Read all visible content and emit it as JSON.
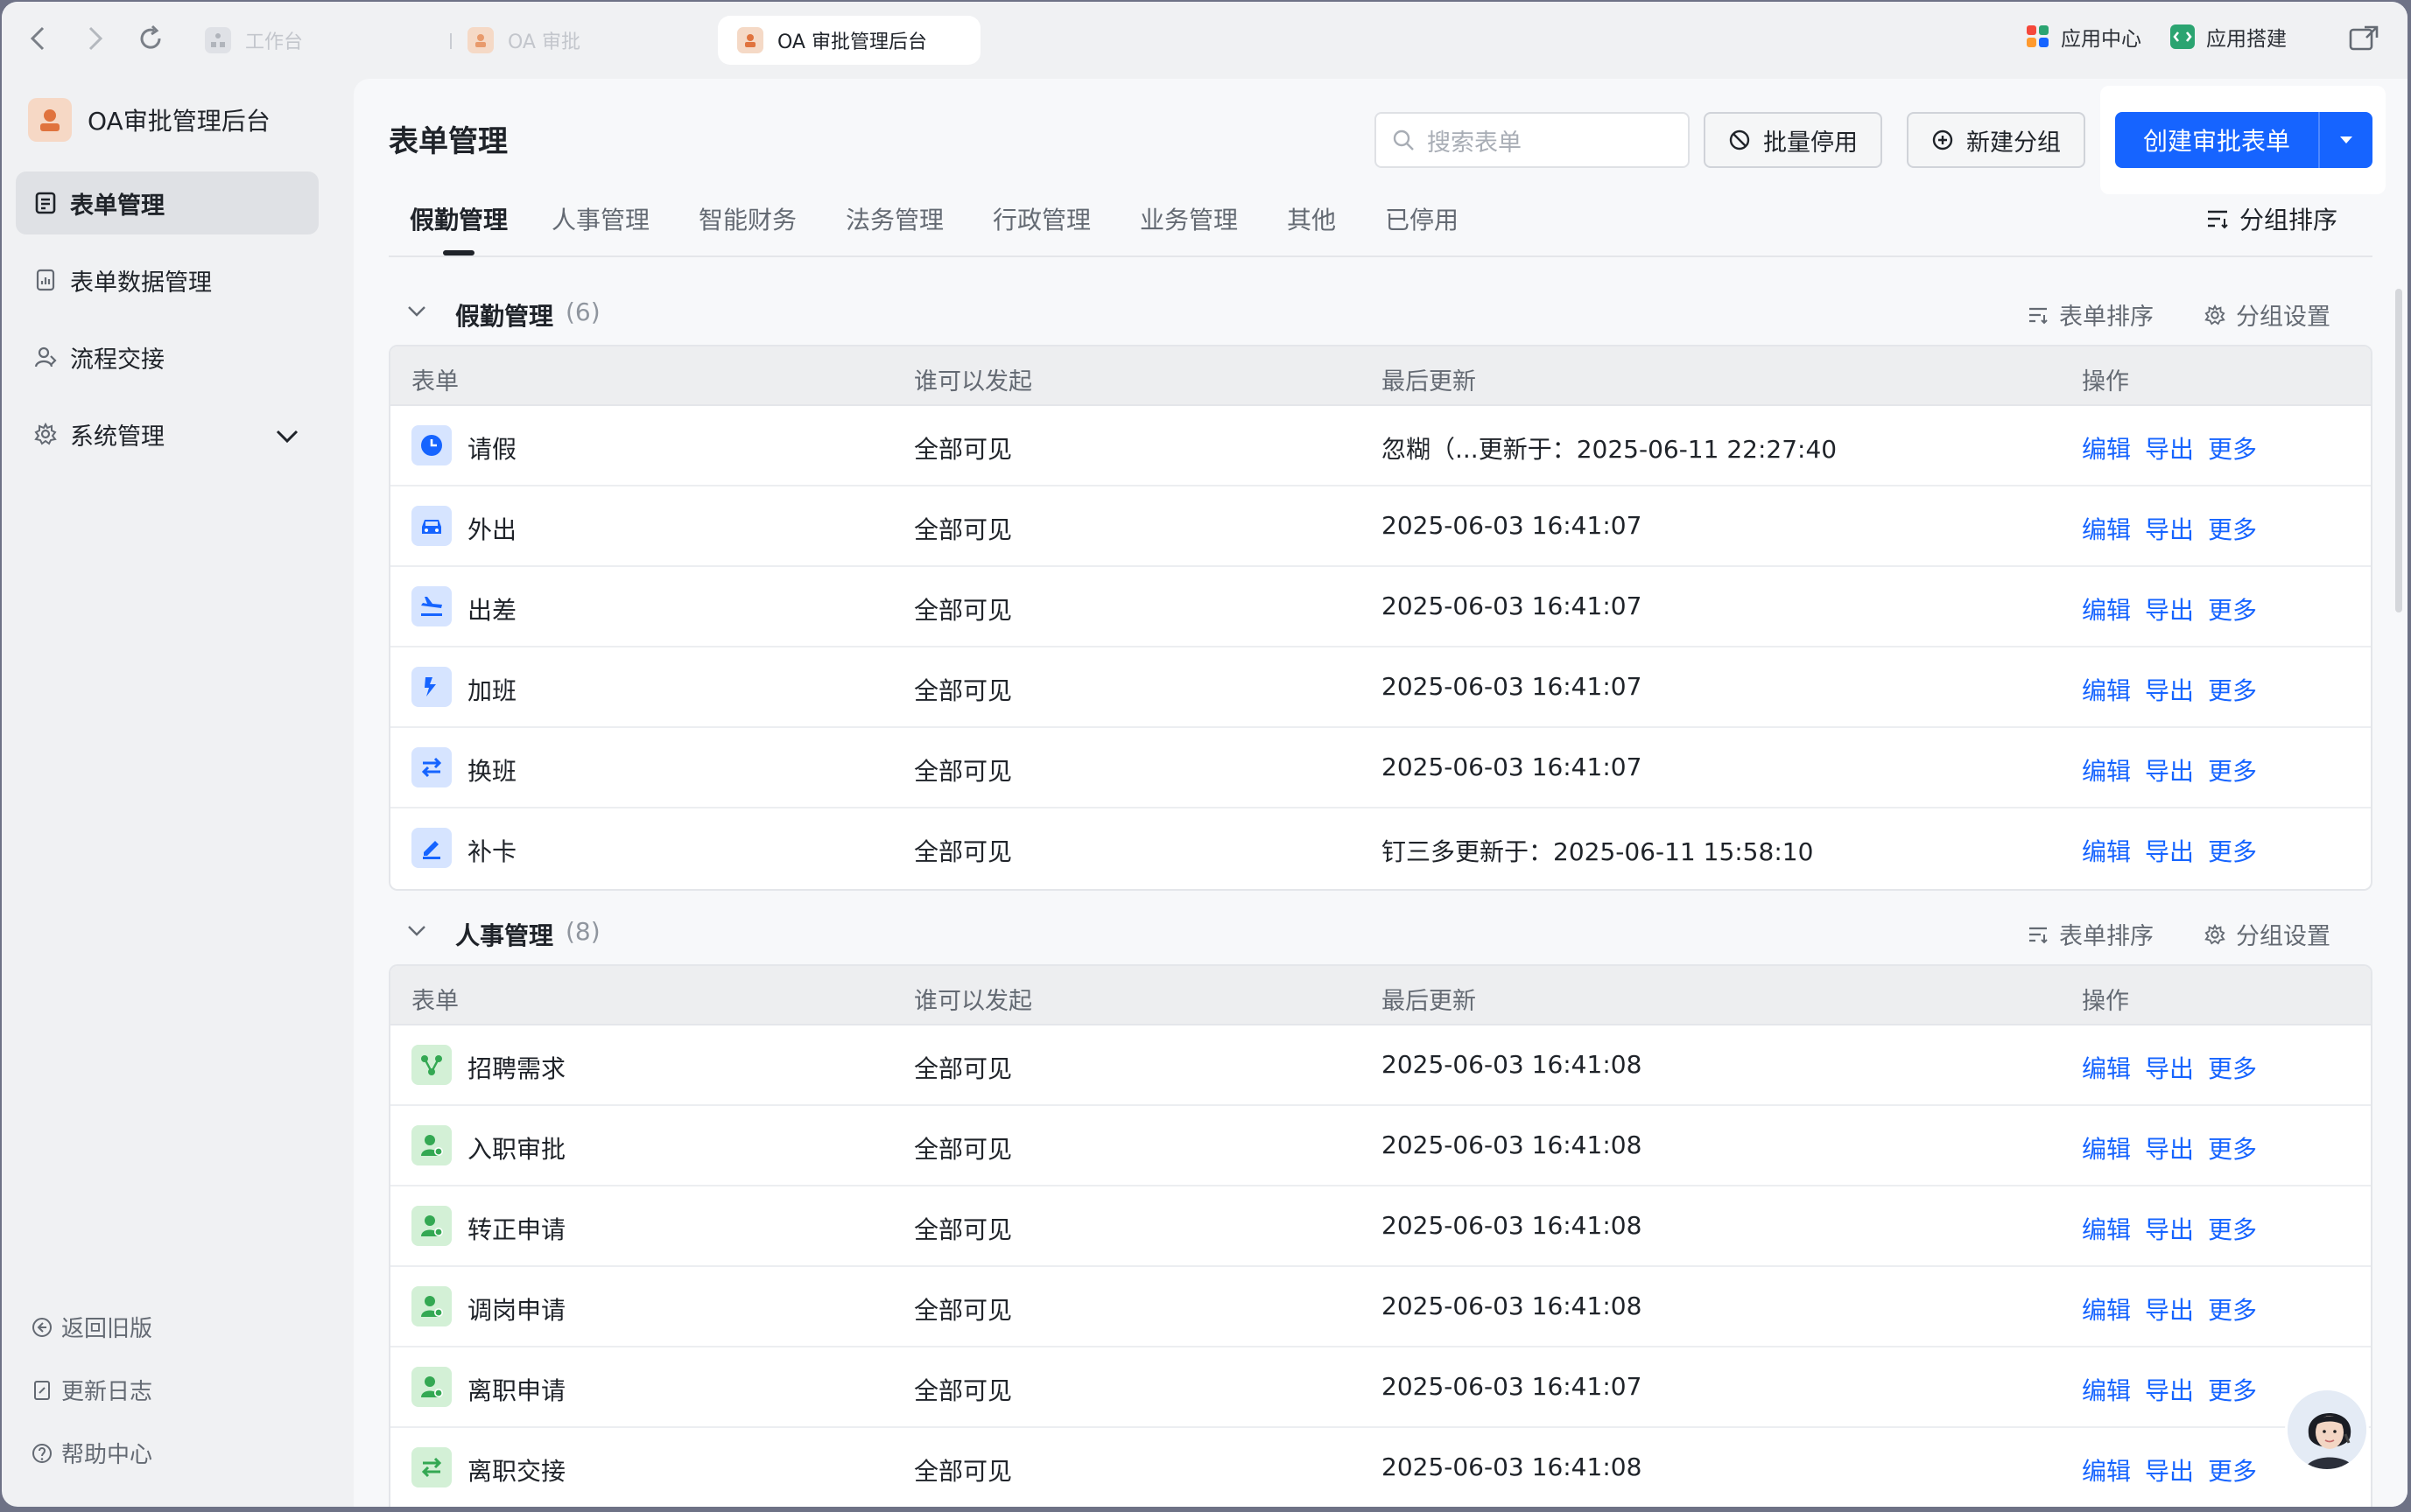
{
  "browser": {
    "tabs": [
      {
        "label": "工作台"
      },
      {
        "label": "OA 审批"
      },
      {
        "label": "OA 审批管理后台"
      }
    ],
    "app_center": "应用中心",
    "app_build": "应用搭建"
  },
  "sidebar": {
    "app_name": "OA审批管理后台",
    "items": [
      {
        "label": "表单管理"
      },
      {
        "label": "表单数据管理"
      },
      {
        "label": "流程交接"
      },
      {
        "label": "系统管理"
      }
    ],
    "footer": [
      {
        "label": "返回旧版"
      },
      {
        "label": "更新日志"
      },
      {
        "label": "帮助中心"
      }
    ]
  },
  "header": {
    "title": "表单管理",
    "search_placeholder": "搜索表单",
    "bulk_disable": "批量停用",
    "new_group": "新建分组",
    "create_form": "创建审批表单"
  },
  "category_tabs": [
    "假勤管理",
    "人事管理",
    "智能财务",
    "法务管理",
    "行政管理",
    "业务管理",
    "其他",
    "已停用"
  ],
  "group_sort": "分组排序",
  "group_actions": {
    "sort": "表单排序",
    "settings": "分组设置"
  },
  "table_headers": {
    "form": "表单",
    "who": "谁可以发起",
    "updated": "最后更新",
    "ops": "操作"
  },
  "row_actions": {
    "edit": "编辑",
    "export": "导出",
    "more": "更多"
  },
  "groups": [
    {
      "name": "假勤管理",
      "count": "(6)",
      "rows": [
        {
          "name": "请假",
          "who": "全部可见",
          "updated": "忽糊（...更新于：2025-06-11 22:27:40",
          "icon": "clock-icon"
        },
        {
          "name": "外出",
          "who": "全部可见",
          "updated": "2025-06-03 16:41:07",
          "icon": "car-icon"
        },
        {
          "name": "出差",
          "who": "全部可见",
          "updated": "2025-06-03 16:41:07",
          "icon": "plane-icon"
        },
        {
          "name": "加班",
          "who": "全部可见",
          "updated": "2025-06-03 16:41:07",
          "icon": "overtime-icon"
        },
        {
          "name": "换班",
          "who": "全部可见",
          "updated": "2025-06-03 16:41:07",
          "icon": "swap-icon"
        },
        {
          "name": "补卡",
          "who": "全部可见",
          "updated": "钉三多更新于：2025-06-11 15:58:10",
          "icon": "pen-icon"
        }
      ]
    },
    {
      "name": "人事管理",
      "count": "(8)",
      "rows": [
        {
          "name": "招聘需求",
          "who": "全部可见",
          "updated": "2025-06-03 16:41:08",
          "icon": "network-icon"
        },
        {
          "name": "入职审批",
          "who": "全部可见",
          "updated": "2025-06-03 16:41:08",
          "icon": "person-add-icon"
        },
        {
          "name": "转正申请",
          "who": "全部可见",
          "updated": "2025-06-03 16:41:08",
          "icon": "person-check-icon"
        },
        {
          "name": "调岗申请",
          "who": "全部可见",
          "updated": "2025-06-03 16:41:08",
          "icon": "person-move-icon"
        },
        {
          "name": "离职申请",
          "who": "全部可见",
          "updated": "2025-06-03 16:41:07",
          "icon": "person-leave-icon"
        },
        {
          "name": "离职交接",
          "who": "全部可见",
          "updated": "2025-06-03 16:41:08",
          "icon": "handover-icon"
        }
      ]
    }
  ],
  "colors": {
    "primary": "#1664ff",
    "leave_icon_bg": "#d6e4ff",
    "hr_icon_bg": "#d3f0d6",
    "hr_icon_fg": "#34a853"
  }
}
